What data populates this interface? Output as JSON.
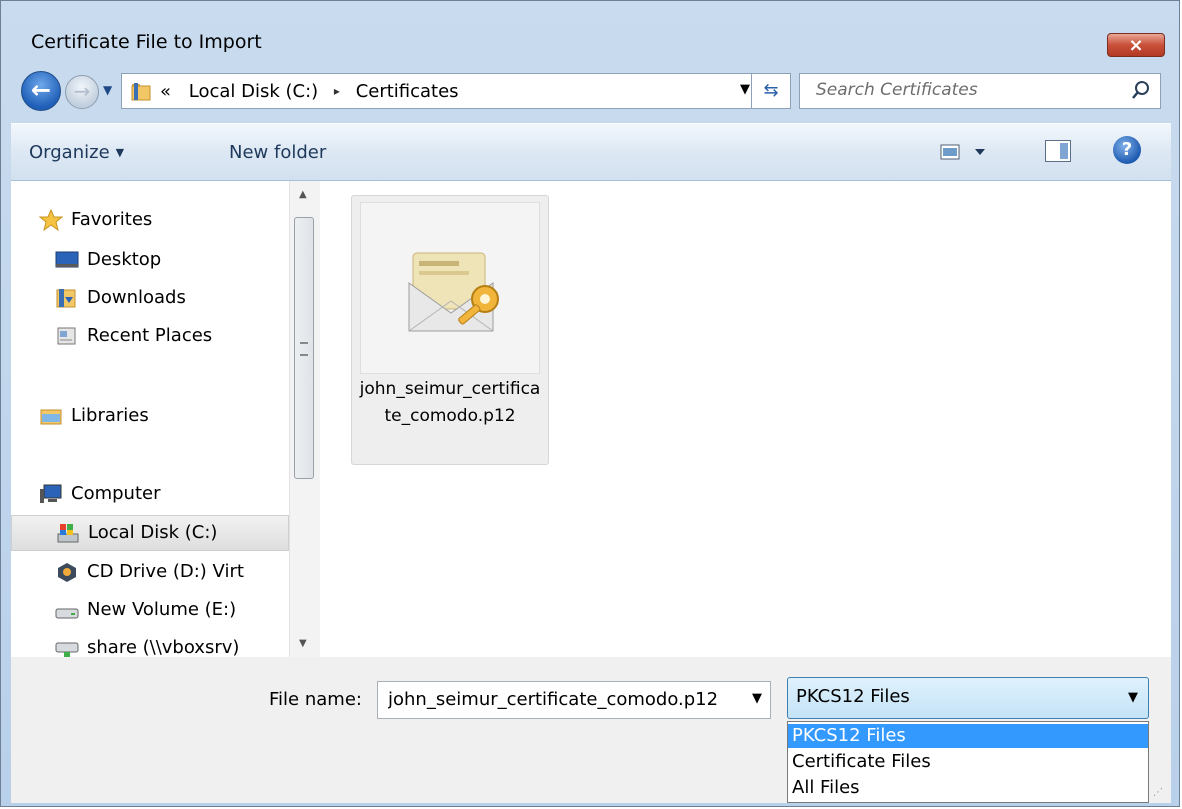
{
  "window": {
    "title": "Certificate File to Import",
    "close_label": "×"
  },
  "address": {
    "crumbs_prefix": "«",
    "crumbs": [
      "Local Disk (C:)",
      "Certificates"
    ],
    "separator": "▸"
  },
  "search": {
    "placeholder": "Search Certificates"
  },
  "toolbar": {
    "organize_label": "Organize",
    "new_folder_label": "New folder",
    "help_label": "?"
  },
  "nav_pane": {
    "items": [
      {
        "label": "Favorites",
        "icon": "star-icon"
      },
      {
        "label": "Desktop",
        "icon": "desktop-icon"
      },
      {
        "label": "Downloads",
        "icon": "downloads-icon"
      },
      {
        "label": "Recent Places",
        "icon": "recent-places-icon"
      },
      {
        "label": "Libraries",
        "icon": "libraries-icon"
      },
      {
        "label": "Computer",
        "icon": "computer-icon"
      },
      {
        "label": "Local Disk (C:)",
        "icon": "local-disk-icon"
      },
      {
        "label": "CD Drive (D:) Virt",
        "icon": "cd-drive-icon"
      },
      {
        "label": "New Volume (E:)",
        "icon": "drive-icon"
      },
      {
        "label": "share (\\\\vboxsrv)",
        "icon": "network-drive-icon"
      }
    ],
    "selected": "Local Disk (C:)"
  },
  "files": [
    {
      "name": "john_seimur_certificate_comodo.p12",
      "icon": "certificate-key-icon"
    }
  ],
  "bottom": {
    "file_name_label": "File name:",
    "file_name_value": "john_seimur_certificate_comodo.p12",
    "file_type_selected": "PKCS12 Files",
    "file_type_options": [
      "PKCS12 Files",
      "Certificate Files",
      "All Files"
    ]
  },
  "colors": {
    "selection": "#3399ff",
    "toolbar_text": "#1e395b"
  }
}
